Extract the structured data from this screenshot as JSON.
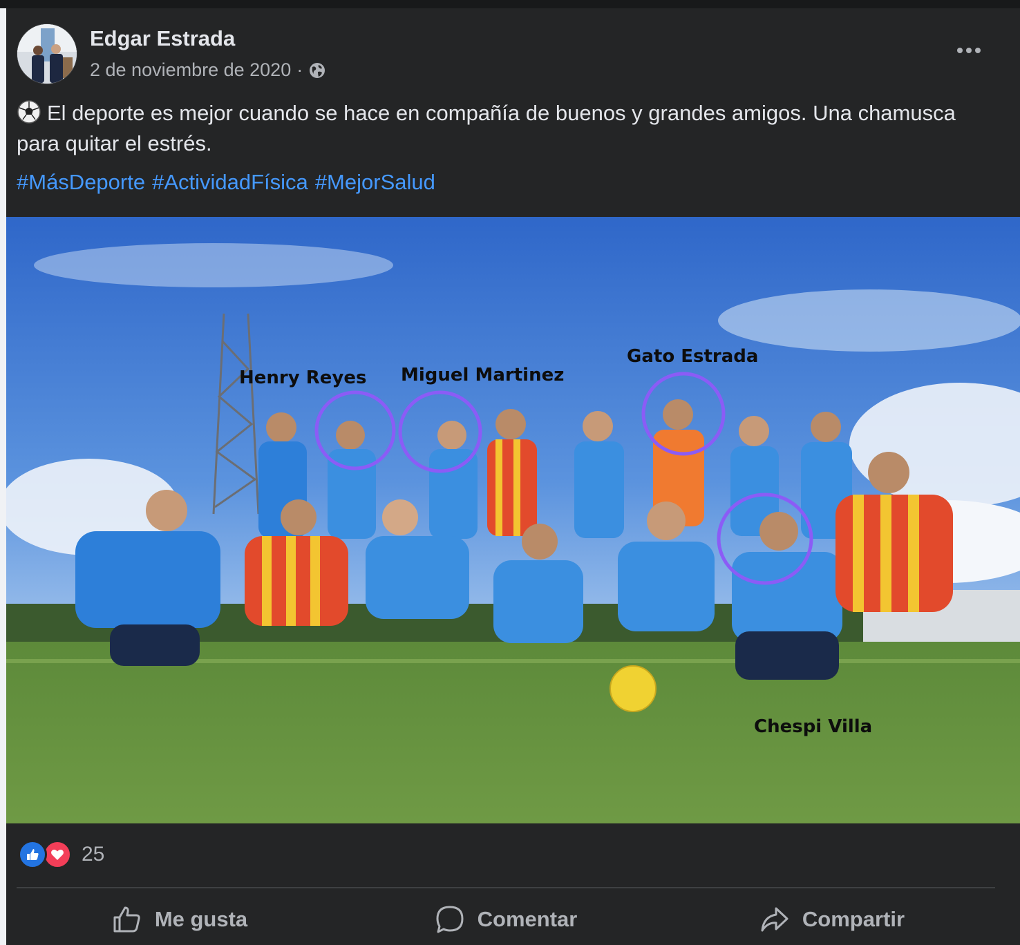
{
  "post": {
    "author": "Edgar Estrada",
    "date": "2 de noviembre de 2020",
    "separator": "·",
    "privacy_icon": "globe-icon",
    "text": "El deporte es mejor cuando se hace en compañía de buenos y grandes amigos. Una chamusca para quitar el estrés.",
    "hashtags": [
      "#MásDeporte",
      "#ActividadFísica",
      "#MejorSalud"
    ]
  },
  "photo": {
    "annotations": [
      {
        "label": "Henry Reyes"
      },
      {
        "label": "Miguel Martinez"
      },
      {
        "label": "Gato Estrada"
      },
      {
        "label": "Chespi Villa"
      }
    ],
    "annotation_circle_color": "#8b5cf6"
  },
  "reactions": {
    "types": [
      "like-icon",
      "love-icon"
    ],
    "count": "25"
  },
  "actions": {
    "like": "Me gusta",
    "comment": "Comentar",
    "share": "Compartir"
  },
  "colors": {
    "background": "#242526",
    "text": "#e4e6eb",
    "secondary_text": "#b0b3b8",
    "hashtag": "#4599ff"
  }
}
